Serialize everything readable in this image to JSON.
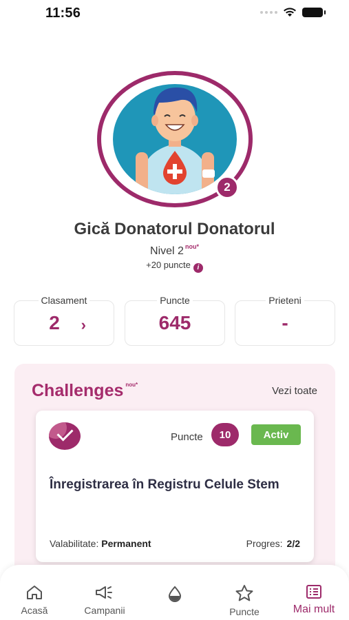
{
  "status_bar": {
    "time": "11:56"
  },
  "profile": {
    "name": "Gică Donatorul Donatorul",
    "level": "Nivel 2",
    "new_tag": "nou*",
    "points_gain": "+20 puncte",
    "badge_level": "2"
  },
  "stats": [
    {
      "label": "Clasament",
      "value": "2"
    },
    {
      "label": "Puncte",
      "value": "645"
    },
    {
      "label": "Prieteni",
      "value": "-"
    }
  ],
  "challenges": {
    "title": "Challenges",
    "new_tag": "nou*",
    "see_all": "Vezi toate",
    "card": {
      "points_label": "Puncte",
      "points": "10",
      "status": "Activ",
      "name": "Înregistrarea în Registru Celule Stem",
      "validity_label": "Valabilitate:",
      "validity_value": "Permanent",
      "progress_label": "Progres:",
      "progress_value": "2/2"
    }
  },
  "nav": [
    {
      "label": "Acasă",
      "icon": "home-icon"
    },
    {
      "label": "Campanii",
      "icon": "megaphone-icon"
    },
    {
      "label": "",
      "icon": "drop-icon"
    },
    {
      "label": "Puncte",
      "icon": "star-icon"
    },
    {
      "label": "Mai mult",
      "icon": "list-icon"
    }
  ],
  "colors": {
    "brand": "#9d2a6a",
    "active": "#6ab84f",
    "panel": "#fbeef3"
  }
}
